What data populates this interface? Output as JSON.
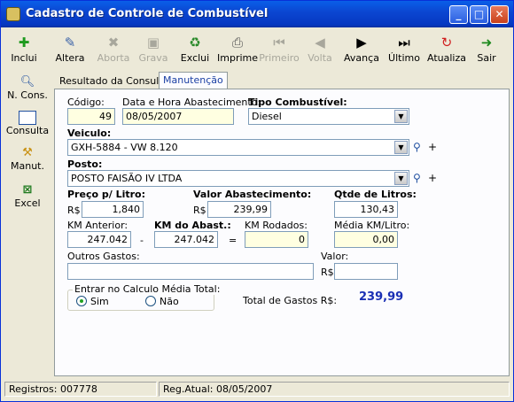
{
  "window": {
    "title": "Cadastro de Controle de Combustível"
  },
  "toolbar": [
    {
      "label": "Inclui",
      "icon": "plus-icon",
      "enabled": true
    },
    {
      "label": "Altera",
      "icon": "edit-icon",
      "enabled": true
    },
    {
      "label": "Aborta",
      "icon": "cancel-icon",
      "enabled": false
    },
    {
      "label": "Grava",
      "icon": "save-icon",
      "enabled": false
    },
    {
      "label": "Exclui",
      "icon": "recycle-icon",
      "enabled": true
    },
    {
      "label": "Imprime",
      "icon": "printer-icon",
      "enabled": true
    },
    {
      "label": "Primeiro",
      "icon": "first-icon",
      "enabled": false
    },
    {
      "label": "Volta",
      "icon": "prev-icon",
      "enabled": false
    },
    {
      "label": "Avança",
      "icon": "next-icon",
      "enabled": true
    },
    {
      "label": "Último",
      "icon": "last-icon",
      "enabled": true
    },
    {
      "label": "Atualiza",
      "icon": "refresh-icon",
      "enabled": true
    },
    {
      "label": "Sair",
      "icon": "exit-icon",
      "enabled": true
    }
  ],
  "sidebar": [
    {
      "label": "N. Cons.",
      "icon": "search-icon"
    },
    {
      "label": "Consulta",
      "icon": "grid-icon"
    },
    {
      "label": "Manut.",
      "icon": "tools-icon"
    },
    {
      "label": "Excel",
      "icon": "excel-icon"
    }
  ],
  "tabs": [
    "Resultado da Consulta",
    "Manutenção"
  ],
  "form": {
    "codigo_label": "Código:",
    "codigo": "49",
    "data_label": "Data e Hora Abastecimento:",
    "data": "08/05/2007",
    "tipo_label": "Tipo Combustível:",
    "tipo": "Diesel",
    "veiculo_label": "Veiculo:",
    "veiculo": "GXH-5884 - VW 8.120",
    "posto_label": "Posto:",
    "posto": "POSTO FAISÃO IV LTDA",
    "preco_label": "Preço p/ Litro:",
    "preco_cur": "R$",
    "preco": "1,840",
    "valor_label": "Valor Abastecimento:",
    "valor_cur": "R$",
    "valor": "239,99",
    "litros_label": "Qtde de Litros:",
    "litros": "130,43",
    "km_ant_label": "KM Anterior:",
    "km_ant": "247.042",
    "minus": "-",
    "km_abast_label": "KM do Abast.:",
    "km_abast": "247.042",
    "equals": "=",
    "km_rod_label": "KM Rodados:",
    "km_rod": "0",
    "media_label": "Média KM/Litro:",
    "media": "0,00",
    "outros_label": "Outros Gastos:",
    "outros": "",
    "outros_valor_label": "Valor:",
    "outros_cur": "R$",
    "outros_valor": "",
    "group_label": "Entrar no Calculo Média Total:",
    "sim": "Sim",
    "nao": "Não",
    "total_label": "Total de Gastos R$:",
    "total": "239,99"
  },
  "status": {
    "registros": "Registros: 007778",
    "reg_atual": "Reg.Atual: 08/05/2007"
  }
}
